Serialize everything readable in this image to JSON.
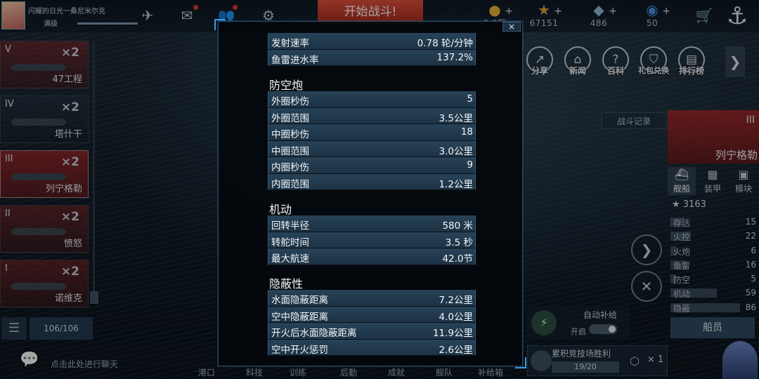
{
  "player": {
    "name": "闪耀的日光一桑尼米尔克",
    "level": "满级"
  },
  "topbar": {
    "start_battle": "开始战斗!",
    "gold": "0.0万",
    "stars": "67151",
    "diamonds": "486",
    "tickets": "50"
  },
  "ship_list": [
    {
      "tier": "V",
      "count": "×2",
      "name": "47工程"
    },
    {
      "tier": "IV",
      "count": "×2",
      "name": "塔什干"
    },
    {
      "tier": "III",
      "count": "×2",
      "name": "列宁格勒"
    },
    {
      "tier": "II",
      "count": "×2",
      "name": "愤怒"
    },
    {
      "tier": "I",
      "count": "×2",
      "name": "诺维克"
    }
  ],
  "ship_count": "106/106",
  "chat_hint": "点击此处进行聊天",
  "bottom_nav": [
    "港口",
    "科技",
    "训练",
    "后勤",
    "成就",
    "舰队",
    "补给箱"
  ],
  "right_icons": [
    "分享",
    "新闻",
    "百科",
    "礼包兑换",
    "排行榜"
  ],
  "battle_log": "战斗记录",
  "selected_ship": {
    "tier": "III",
    "name": "列宁格勒"
  },
  "tabs": [
    "舰船",
    "装甲",
    "模块"
  ],
  "rating": "3163",
  "ship_stats": [
    {
      "label": "存活",
      "value": "15",
      "level": 0.18
    },
    {
      "label": "火控",
      "value": "22",
      "level": 0.26
    },
    {
      "label": "火炮",
      "value": "6",
      "level": 0.08
    },
    {
      "label": "鱼雷",
      "value": "16",
      "level": 0.2
    },
    {
      "label": "防空",
      "value": "5",
      "level": 0.06
    },
    {
      "label": "机动",
      "value": "59",
      "level": 0.6
    },
    {
      "label": "隐蔽",
      "value": "86",
      "level": 0.9
    }
  ],
  "crew_button": "船员",
  "auto_supply": {
    "label": "自动补给",
    "toggle_label": "开启"
  },
  "arena": {
    "title": "累积竞技场胜利",
    "progress": "19/20",
    "multiplier": "× 1"
  },
  "modal": {
    "close": "×",
    "top_rows": [
      {
        "k": "发射速率",
        "v": "0.78 轮/分钟"
      },
      {
        "k": "鱼雷进水率",
        "v": "137.2%"
      }
    ],
    "aa_title": "防空炮",
    "aa_rows": [
      {
        "k": "外圈秒伤",
        "v": "5"
      },
      {
        "k": "外圈范围",
        "v": "3.5公里"
      },
      {
        "k": "中圈秒伤",
        "v": "18"
      },
      {
        "k": "中圈范围",
        "v": "3.0公里"
      },
      {
        "k": "内圈秒伤",
        "v": "9"
      },
      {
        "k": "内圈范围",
        "v": "1.2公里"
      }
    ],
    "mob_title": "机动",
    "mob_rows": [
      {
        "k": "回转半径",
        "v": "580 米"
      },
      {
        "k": "转舵时间",
        "v": "3.5 秒"
      },
      {
        "k": "最大航速",
        "v": "42.0节"
      }
    ],
    "con_title": "隐蔽性",
    "con_rows": [
      {
        "k": "水面隐蔽距离",
        "v": "7.2公里"
      },
      {
        "k": "空中隐蔽距离",
        "v": "4.0公里"
      },
      {
        "k": "开火后水面隐蔽距离",
        "v": "11.9公里"
      },
      {
        "k": "空中开火惩罚",
        "v": "2.6公里"
      }
    ]
  }
}
